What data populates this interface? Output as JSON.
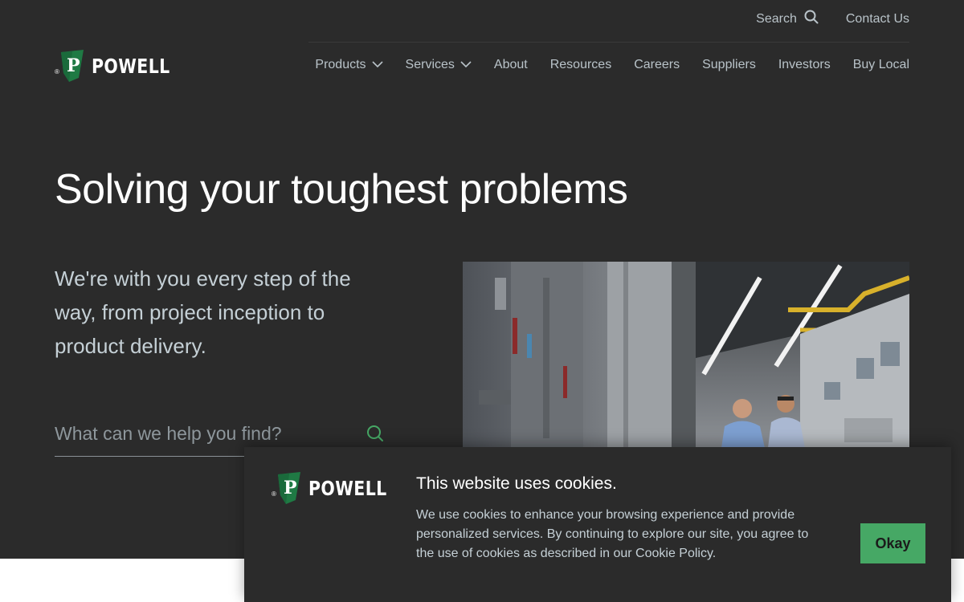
{
  "brand": {
    "name": "POWELL",
    "logo_letter": "P",
    "registered_mark": "®",
    "logo_color": "#1f7a44"
  },
  "utility_nav": {
    "search_label": "Search",
    "contact_label": "Contact Us"
  },
  "main_nav": {
    "items": [
      {
        "label": "Products",
        "has_dropdown": true
      },
      {
        "label": "Services",
        "has_dropdown": true
      },
      {
        "label": "About",
        "has_dropdown": false
      },
      {
        "label": "Resources",
        "has_dropdown": false
      },
      {
        "label": "Careers",
        "has_dropdown": false
      },
      {
        "label": "Suppliers",
        "has_dropdown": false
      },
      {
        "label": "Investors",
        "has_dropdown": false
      },
      {
        "label": "Buy Local",
        "has_dropdown": false
      }
    ]
  },
  "hero": {
    "title": "Solving your toughest problems",
    "subtitle": "We're with you every step of the way, from project inception to product delivery.",
    "search_placeholder": "What can we help you find?",
    "search_icon": "search-icon",
    "accent_color": "#46a865"
  },
  "cookie_banner": {
    "title": "This website uses cookies.",
    "text": "We use cookies to enhance your browsing experience and provide personalized services. By continuing to explore our site, you agree to the use of cookies as described in our Cookie Policy.",
    "button_label": "Okay",
    "button_color": "#46a865"
  },
  "colors": {
    "background": "#2b2b2b",
    "nav_text": "#b9c3c9"
  }
}
